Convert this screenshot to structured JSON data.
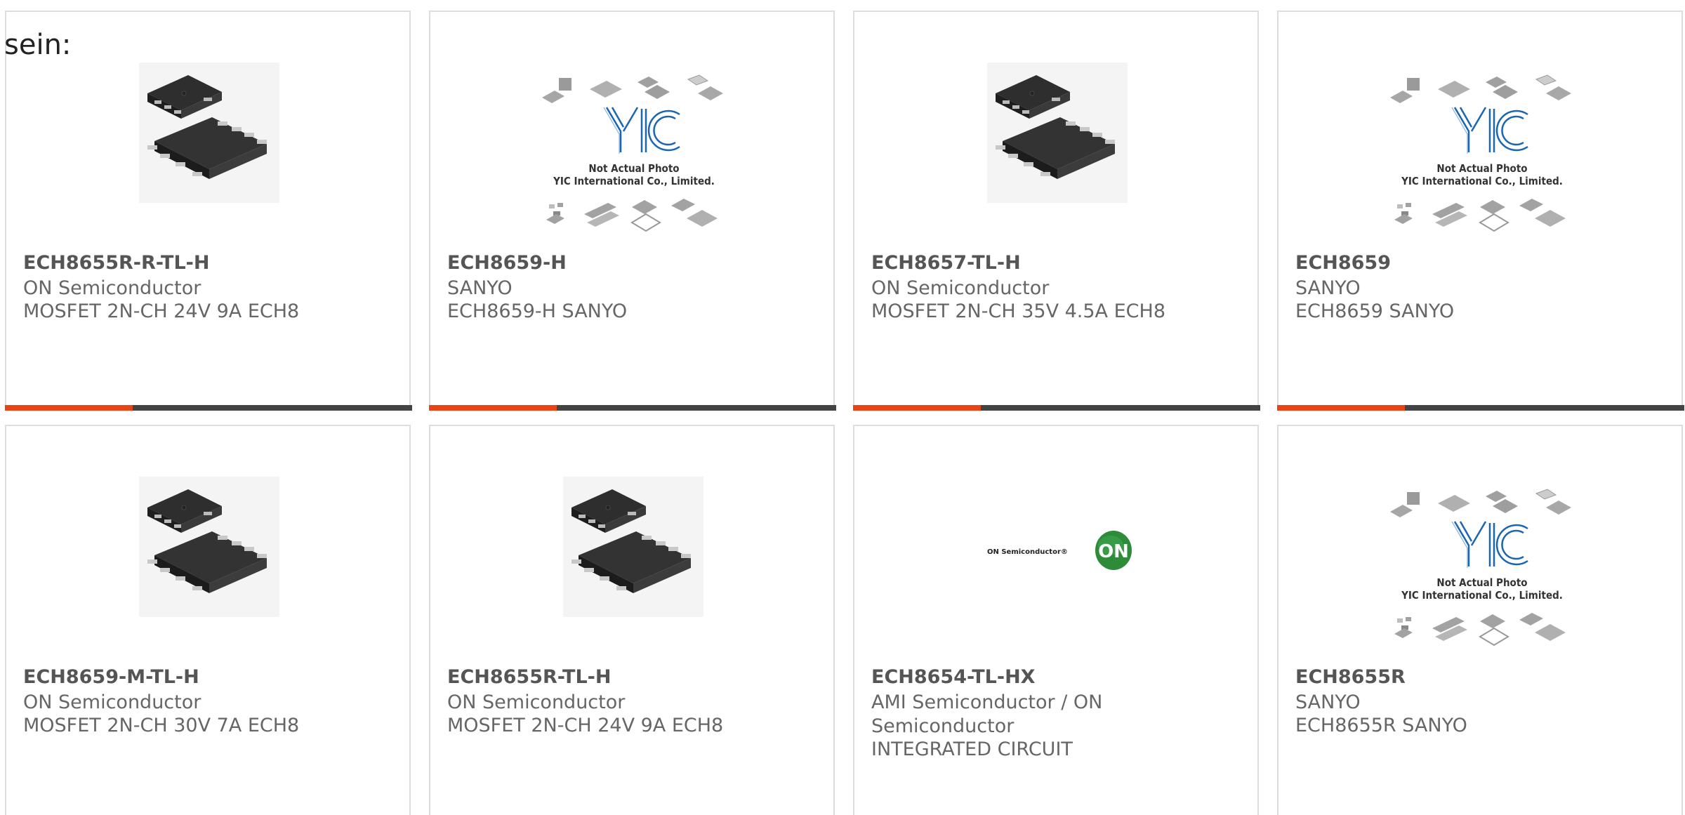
{
  "intro_text": "sein:",
  "colors": {
    "accent": "#e84416",
    "bar": "#444444",
    "card_border": "#dddddd",
    "chip": "#2e2e2e",
    "yic_blue": "#1a66b3",
    "on_green": "#2e8b3a"
  },
  "cards": [
    {
      "part": "ECH8655R-R-TL-H",
      "maker": "ON Semiconductor",
      "desc": "MOSFET 2N-CH 24V 9A ECH8",
      "image": "chip-photo",
      "bar": true
    },
    {
      "part": "ECH8659-H",
      "maker": "SANYO",
      "desc": "ECH8659-H SANYO",
      "image": "yic-placeholder",
      "bar": true
    },
    {
      "part": "ECH8657-TL-H",
      "maker": "ON Semiconductor",
      "desc": "MOSFET 2N-CH 35V 4.5A ECH8",
      "image": "chip-photo",
      "bar": true
    },
    {
      "part": "ECH8659",
      "maker": "SANYO",
      "desc": "ECH8659 SANYO",
      "image": "yic-placeholder",
      "bar": true
    },
    {
      "part": "ECH8659-M-TL-H",
      "maker": "ON Semiconductor",
      "desc": "MOSFET 2N-CH 30V 7A ECH8",
      "image": "chip-photo",
      "bar": false
    },
    {
      "part": "ECH8655R-TL-H",
      "maker": "ON Semiconductor",
      "desc": "MOSFET 2N-CH 24V 9A ECH8",
      "image": "chip-photo",
      "bar": false
    },
    {
      "part": "ECH8654-TL-HX",
      "maker": "AMI Semiconductor / ON Semiconductor",
      "desc": "INTEGRATED CIRCUIT",
      "image": "on-logo",
      "bar": false
    },
    {
      "part": "ECH8655R",
      "maker": "SANYO",
      "desc": "ECH8655R SANYO",
      "image": "yic-placeholder",
      "bar": false
    }
  ],
  "yic": {
    "logo": "YIC",
    "line1": "Not Actual Photo",
    "line2": "YIC International Co., Limited."
  },
  "on_logo": {
    "wordmark": "ON Semiconductor®",
    "badge": "ON"
  }
}
